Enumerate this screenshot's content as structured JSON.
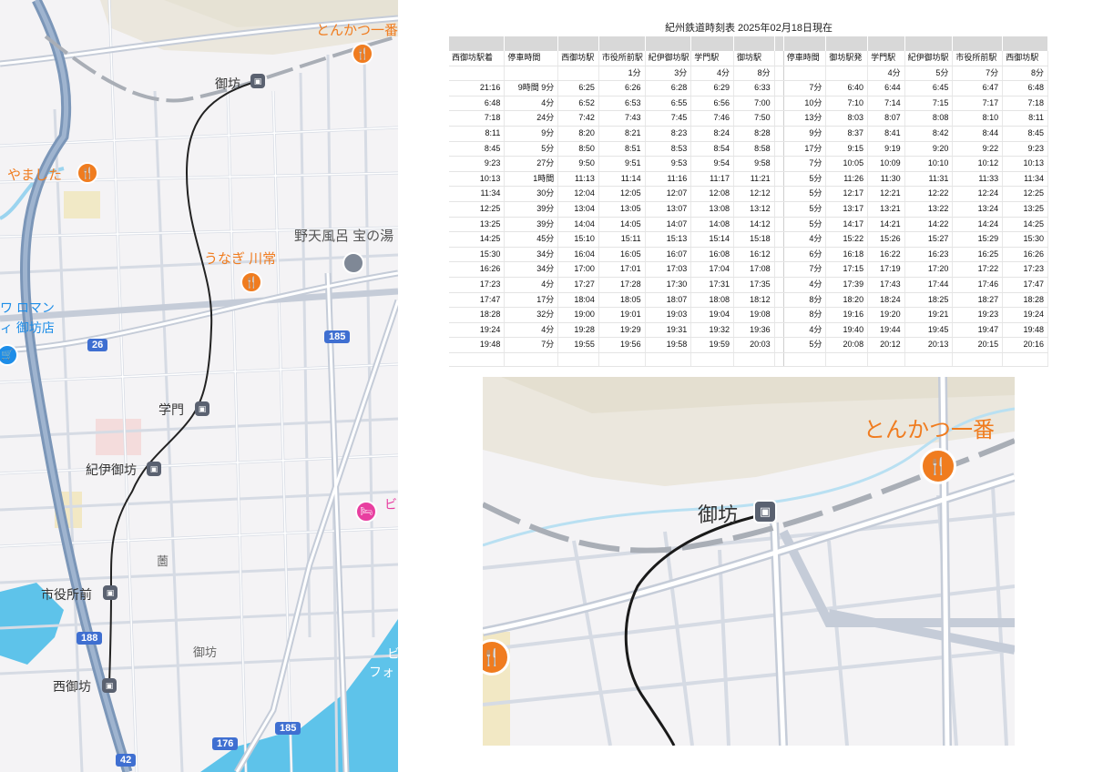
{
  "timetable": {
    "title": "紀州鉄道時刻表 2025年02月18日現在",
    "columns": [
      "西御坊駅着",
      "停車時間",
      "西御坊駅",
      "市役所前駅",
      "紀伊御坊駅",
      "学門駅",
      "御坊駅",
      "",
      "停車時間",
      "御坊駅発",
      "学門駅",
      "紀伊御坊駅",
      "市役所前駅",
      "西御坊駅"
    ],
    "durations": [
      "",
      "",
      "",
      "1分",
      "3分",
      "4分",
      "8分",
      "",
      "",
      "",
      "4分",
      "5分",
      "7分",
      "8分"
    ],
    "rows": [
      [
        "21:16",
        "9時間 9分",
        "6:25",
        "6:26",
        "6:28",
        "6:29",
        "6:33",
        "",
        "7分",
        "6:40",
        "6:44",
        "6:45",
        "6:47",
        "6:48"
      ],
      [
        "6:48",
        "4分",
        "6:52",
        "6:53",
        "6:55",
        "6:56",
        "7:00",
        "",
        "10分",
        "7:10",
        "7:14",
        "7:15",
        "7:17",
        "7:18"
      ],
      [
        "7:18",
        "24分",
        "7:42",
        "7:43",
        "7:45",
        "7:46",
        "7:50",
        "",
        "13分",
        "8:03",
        "8:07",
        "8:08",
        "8:10",
        "8:11"
      ],
      [
        "8:11",
        "9分",
        "8:20",
        "8:21",
        "8:23",
        "8:24",
        "8:28",
        "",
        "9分",
        "8:37",
        "8:41",
        "8:42",
        "8:44",
        "8:45"
      ],
      [
        "8:45",
        "5分",
        "8:50",
        "8:51",
        "8:53",
        "8:54",
        "8:58",
        "",
        "17分",
        "9:15",
        "9:19",
        "9:20",
        "9:22",
        "9:23"
      ],
      [
        "9:23",
        "27分",
        "9:50",
        "9:51",
        "9:53",
        "9:54",
        "9:58",
        "",
        "7分",
        "10:05",
        "10:09",
        "10:10",
        "10:12",
        "10:13"
      ],
      [
        "10:13",
        "1時間",
        "11:13",
        "11:14",
        "11:16",
        "11:17",
        "11:21",
        "",
        "5分",
        "11:26",
        "11:30",
        "11:31",
        "11:33",
        "11:34"
      ],
      [
        "11:34",
        "30分",
        "12:04",
        "12:05",
        "12:07",
        "12:08",
        "12:12",
        "",
        "5分",
        "12:17",
        "12:21",
        "12:22",
        "12:24",
        "12:25"
      ],
      [
        "12:25",
        "39分",
        "13:04",
        "13:05",
        "13:07",
        "13:08",
        "13:12",
        "",
        "5分",
        "13:17",
        "13:21",
        "13:22",
        "13:24",
        "13:25"
      ],
      [
        "13:25",
        "39分",
        "14:04",
        "14:05",
        "14:07",
        "14:08",
        "14:12",
        "",
        "5分",
        "14:17",
        "14:21",
        "14:22",
        "14:24",
        "14:25"
      ],
      [
        "14:25",
        "45分",
        "15:10",
        "15:11",
        "15:13",
        "15:14",
        "15:18",
        "",
        "4分",
        "15:22",
        "15:26",
        "15:27",
        "15:29",
        "15:30"
      ],
      [
        "15:30",
        "34分",
        "16:04",
        "16:05",
        "16:07",
        "16:08",
        "16:12",
        "",
        "6分",
        "16:18",
        "16:22",
        "16:23",
        "16:25",
        "16:26"
      ],
      [
        "16:26",
        "34分",
        "17:00",
        "17:01",
        "17:03",
        "17:04",
        "17:08",
        "",
        "7分",
        "17:15",
        "17:19",
        "17:20",
        "17:22",
        "17:23"
      ],
      [
        "17:23",
        "4分",
        "17:27",
        "17:28",
        "17:30",
        "17:31",
        "17:35",
        "",
        "4分",
        "17:39",
        "17:43",
        "17:44",
        "17:46",
        "17:47"
      ],
      [
        "17:47",
        "17分",
        "18:04",
        "18:05",
        "18:07",
        "18:08",
        "18:12",
        "",
        "8分",
        "18:20",
        "18:24",
        "18:25",
        "18:27",
        "18:28"
      ],
      [
        "18:28",
        "32分",
        "19:00",
        "19:01",
        "19:03",
        "19:04",
        "19:08",
        "",
        "8分",
        "19:16",
        "19:20",
        "19:21",
        "19:23",
        "19:24"
      ],
      [
        "19:24",
        "4分",
        "19:28",
        "19:29",
        "19:31",
        "19:32",
        "19:36",
        "",
        "4分",
        "19:40",
        "19:44",
        "19:45",
        "19:47",
        "19:48"
      ],
      [
        "19:48",
        "7分",
        "19:55",
        "19:56",
        "19:58",
        "19:59",
        "20:03",
        "",
        "5分",
        "20:08",
        "20:12",
        "20:13",
        "20:15",
        "20:16"
      ],
      [
        "",
        "",
        "",
        "",
        "",
        "",
        "",
        "",
        "",
        "",
        "",
        "",
        "",
        ""
      ]
    ]
  },
  "map_left": {
    "stations": {
      "gobo": "御坊",
      "gakumon": "学門",
      "kii_gobo": "紀伊御坊",
      "shiyakusho_mae": "市役所前",
      "nishi_gobo": "西御坊"
    },
    "pois": {
      "tonkatsu": "とんかつ一番",
      "yamashita": "やました",
      "unagi": "うなぎ 川常",
      "onsen": "野天風呂 宝の湯",
      "shop_line1": "ワ ロマン",
      "shop_line2": "ィ 御坊店",
      "hotel": "ビ",
      "beach_line1": "ビ",
      "beach_line2": "フォ"
    },
    "areas": {
      "sono": "薗",
      "gobo_town": "御坊"
    },
    "routes": [
      "26",
      "185",
      "188",
      "185",
      "176",
      "42"
    ]
  },
  "map_zoom": {
    "station": "御坊",
    "poi": "とんかつ一番"
  },
  "colors": {
    "poi_orange": "#f07c1f",
    "rail_black": "#222222",
    "water": "#5ec3ea",
    "road_blue": "#7b96b8",
    "hotel_pink": "#e83fa0",
    "shop_blue": "#1d8de8"
  }
}
